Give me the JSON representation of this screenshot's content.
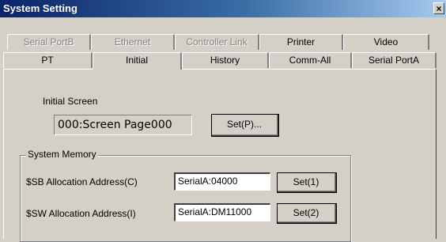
{
  "window": {
    "title": "System Setting",
    "close_label": "×"
  },
  "tabs": {
    "row1": [
      {
        "label": "Serial PortB",
        "enabled": false
      },
      {
        "label": "Ethernet",
        "enabled": false
      },
      {
        "label": "Controller Link",
        "enabled": false
      },
      {
        "label": "Printer",
        "enabled": true
      },
      {
        "label": "Video",
        "enabled": true
      }
    ],
    "row2": [
      {
        "label": "PT",
        "enabled": true
      },
      {
        "label": "Initial",
        "enabled": true,
        "selected": true
      },
      {
        "label": "History",
        "enabled": true
      },
      {
        "label": "Comm-All",
        "enabled": true
      },
      {
        "label": "Serial PortA",
        "enabled": true
      }
    ]
  },
  "initial_screen": {
    "label": "Initial Screen",
    "value": "000:Screen Page000",
    "set_button": "Set(P)..."
  },
  "system_memory": {
    "title": "System Memory",
    "sb_label": "$SB Allocation Address(C)",
    "sb_value": "SerialA:04000",
    "sb_button": "Set(1)",
    "sw_label": "$SW Allocation Address(I)",
    "sw_value": "SerialA:DM11000",
    "sw_button": "Set(2)"
  }
}
